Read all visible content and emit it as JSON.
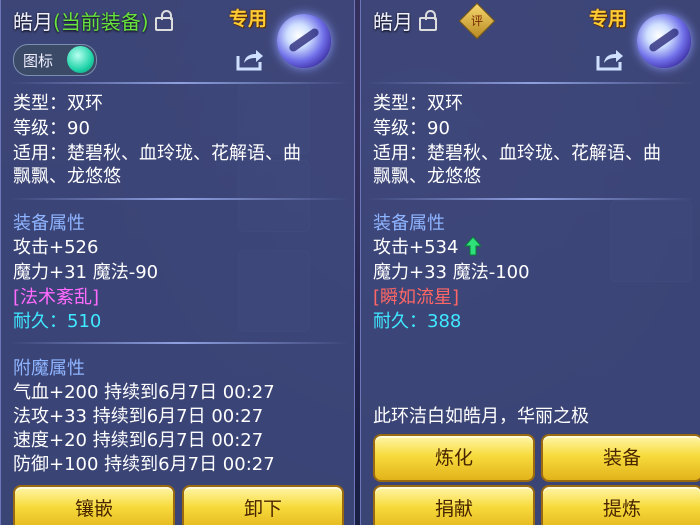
{
  "left": {
    "title_name": "皓月",
    "title_status": "(当前装备)",
    "exclusive": "专用",
    "toggle_label": "图标",
    "type_line": "类型：双环",
    "level_line": "等级：90",
    "suit_line1": "适用：楚碧秋、血玲珑、花解语、曲",
    "suit_line2": "飘飘、龙悠悠",
    "attr_header": "装备属性",
    "attack": "攻击+526",
    "magic": "魔力+31 魔法-90",
    "special": "[法术紊乱]",
    "durability": "耐久：510",
    "enchant_header": "附魔属性",
    "enchants": [
      "气血+200 持续到6月7日 00:27",
      "法攻+33 持续到6月7日 00:27",
      "速度+20 持续到6月7日 00:27",
      "防御+100 持续到6月7日 00:27"
    ],
    "buttons": {
      "inlay": "镶嵌",
      "unequip": "卸下"
    }
  },
  "right": {
    "title_name": "皓月",
    "rating_badge": "评",
    "exclusive": "专用",
    "type_line": "类型：双环",
    "level_line": "等级：90",
    "suit_line1": "适用：楚碧秋、血玲珑、花解语、曲",
    "suit_line2": "飘飘、龙悠悠",
    "attr_header": "装备属性",
    "attack": "攻击+534",
    "magic": "魔力+33 魔法-100",
    "special": "[瞬如流星]",
    "durability": "耐久：388",
    "description": "此环洁白如皓月，华丽之极",
    "buttons": {
      "refine": "炼化",
      "equip": "装备",
      "donate": "捐献",
      "extract": "提炼"
    }
  },
  "colors": {
    "panel": "#404a7e",
    "header": "#8fb4ff",
    "special_left": "#ff6aff",
    "special_right": "#ff6666",
    "durability": "#3fe9ff",
    "button": "#f7db3c"
  }
}
